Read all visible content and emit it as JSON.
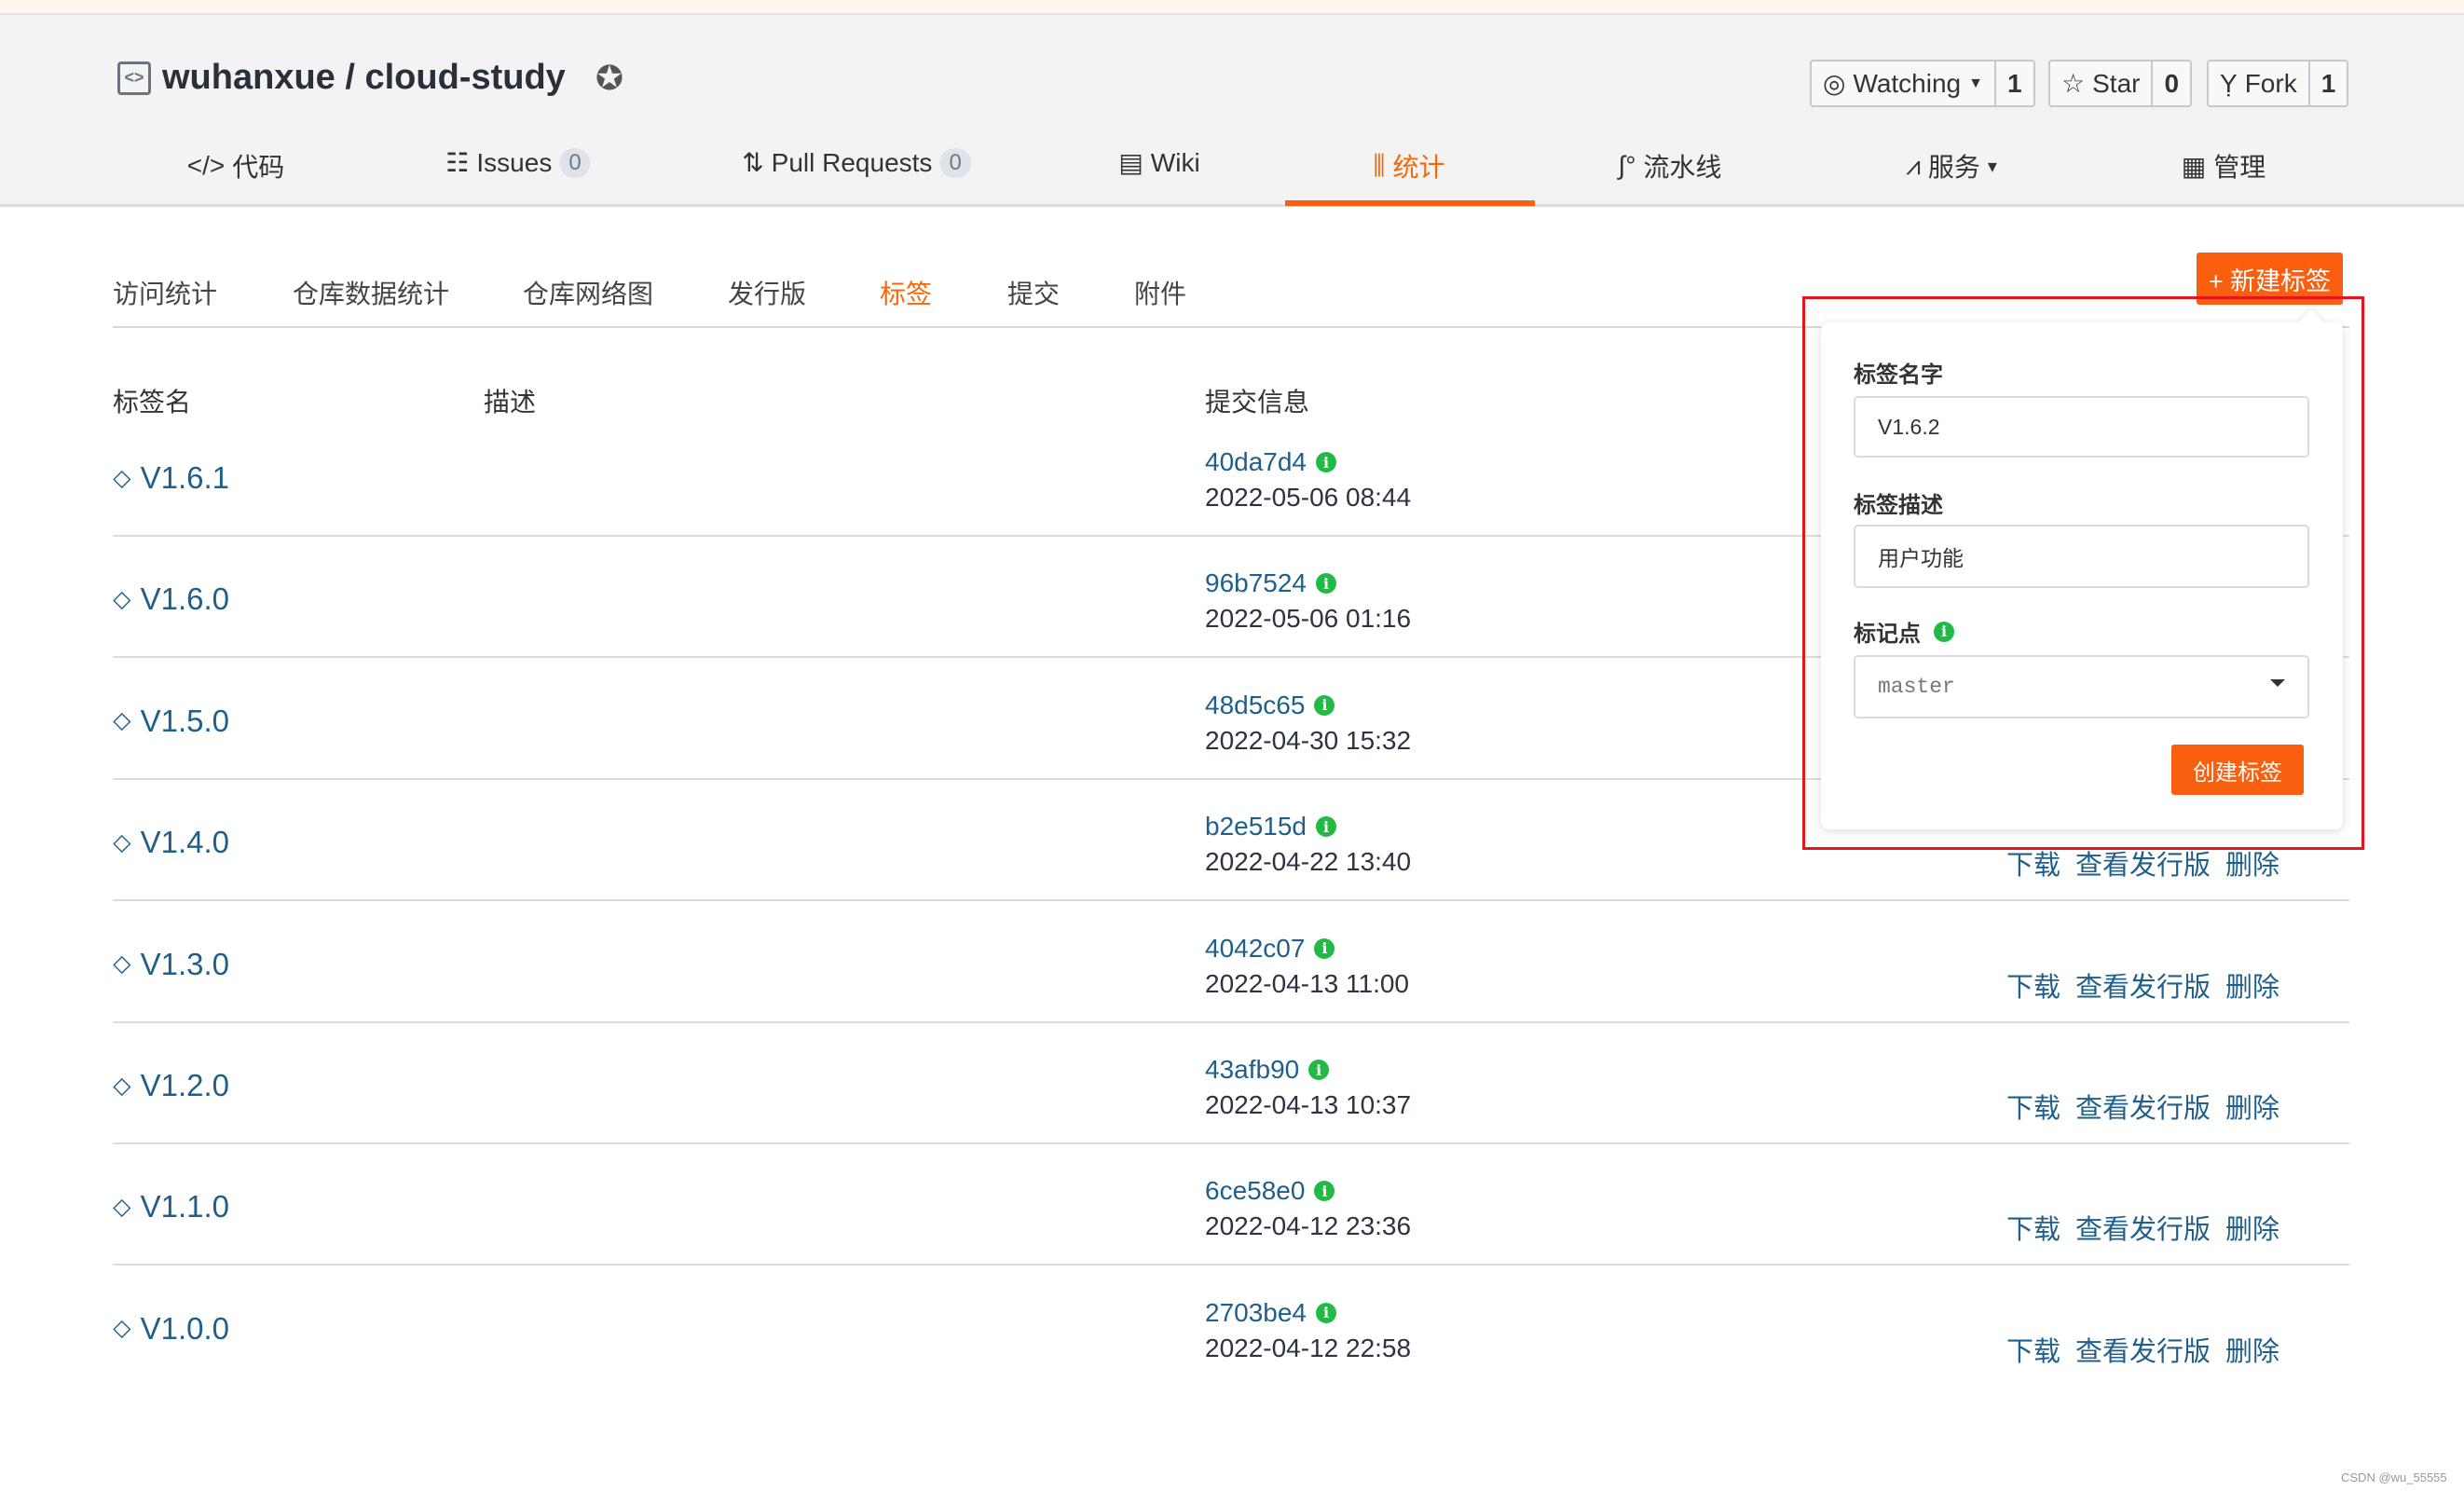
{
  "repo": {
    "title": "wuhanxue / cloud-study",
    "icon": "repo-code-icon",
    "badge_icon": "award-icon"
  },
  "header_buttons": [
    {
      "label": "Watching",
      "count": "1",
      "icon": "eye-icon",
      "dropdown": true
    },
    {
      "label": "Star",
      "count": "0",
      "icon": "star-icon"
    },
    {
      "label": "Fork",
      "count": "1",
      "icon": "fork-icon"
    }
  ],
  "nav": [
    {
      "label": "代码",
      "icon": "</>"
    },
    {
      "label": "Issues",
      "icon": "☷",
      "count": "0"
    },
    {
      "label": "Pull Requests",
      "icon": "⇅",
      "count": "0"
    },
    {
      "label": "Wiki",
      "icon": "▤"
    },
    {
      "label": "统计",
      "icon": "⫼",
      "active": true
    },
    {
      "label": "流水线",
      "icon": "∫°"
    },
    {
      "label": "服务",
      "icon": "⩘",
      "dropdown": "▾"
    },
    {
      "label": "管理",
      "icon": "▦"
    }
  ],
  "sub_tabs": [
    "访问统计",
    "仓库数据统计",
    "仓库网络图",
    "发行版",
    "标签",
    "提交",
    "附件"
  ],
  "active_sub_tab": "标签",
  "new_tag_button": "+ 新建标签",
  "columns": {
    "name": "标签名",
    "desc": "描述",
    "commit": "提交信息"
  },
  "tags": [
    {
      "name": "V1.6.1",
      "hash": "40da7d4",
      "date": "2022-05-06 08:44"
    },
    {
      "name": "V1.6.0",
      "hash": "96b7524",
      "date": "2022-05-06 01:16"
    },
    {
      "name": "V1.5.0",
      "hash": "48d5c65",
      "date": "2022-04-30 15:32"
    },
    {
      "name": "V1.4.0",
      "hash": "b2e515d",
      "date": "2022-04-22 13:40"
    },
    {
      "name": "V1.3.0",
      "hash": "4042c07",
      "date": "2022-04-13 11:00"
    },
    {
      "name": "V1.2.0",
      "hash": "43afb90",
      "date": "2022-04-13 10:37"
    },
    {
      "name": "V1.1.0",
      "hash": "6ce58e0",
      "date": "2022-04-12 23:36"
    },
    {
      "name": "V1.0.0",
      "hash": "2703be4",
      "date": "2022-04-12 22:58"
    }
  ],
  "row_actions": {
    "download": "下载",
    "view_release": "查看发行版",
    "delete": "删除"
  },
  "popover": {
    "name_label": "标签名字",
    "name_value": "V1.6.2",
    "desc_label": "标签描述",
    "desc_value": "用户功能",
    "point_label": "标记点",
    "point_value": "master",
    "create_button": "创建标签"
  },
  "colors": {
    "accent": "#fa5f0f",
    "link": "#1f5f8b",
    "info": "#21ba45",
    "highlight_box": "#e8141b"
  },
  "watermark": "CSDN @wu_55555"
}
